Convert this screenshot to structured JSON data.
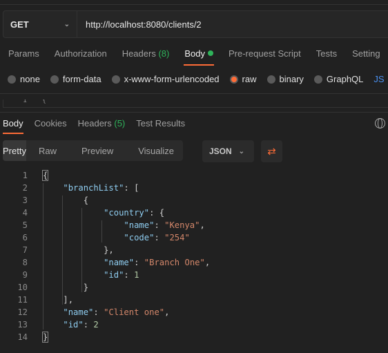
{
  "request": {
    "method": "GET",
    "url": "http://localhost:8080/clients/2"
  },
  "request_tabs": [
    {
      "label": "Params"
    },
    {
      "label": "Authorization"
    },
    {
      "label": "Headers",
      "count": "(8)"
    },
    {
      "label": "Body",
      "active": true
    },
    {
      "label": "Pre-request Script"
    },
    {
      "label": "Tests"
    },
    {
      "label": "Setting"
    }
  ],
  "body_types": [
    {
      "label": "none"
    },
    {
      "label": "form-data"
    },
    {
      "label": "x-www-form-urlencoded"
    },
    {
      "label": "raw",
      "selected": true
    },
    {
      "label": "binary"
    },
    {
      "label": "GraphQL"
    }
  ],
  "body_format_partial": "JS",
  "editor": {
    "line_number": "1",
    "content": "{"
  },
  "response_tabs": [
    {
      "label": "Body",
      "active": true
    },
    {
      "label": "Cookies"
    },
    {
      "label": "Headers",
      "count": "(5)"
    },
    {
      "label": "Test Results"
    }
  ],
  "view_modes": [
    "Pretty",
    "Raw",
    "Preview",
    "Visualize"
  ],
  "format": "JSON",
  "colors": {
    "accent": "#ff6c37",
    "success": "#2fb35a",
    "key": "#8fcdf0",
    "string": "#d4876a",
    "number": "#b5cea8"
  },
  "code_lines": [
    {
      "indent": 0,
      "tokens": [
        [
          "p",
          "{"
        ]
      ]
    },
    {
      "indent": 1,
      "tokens": [
        [
          "k",
          "\"branchList\""
        ],
        [
          "p",
          ": ["
        ]
      ]
    },
    {
      "indent": 2,
      "tokens": [
        [
          "p",
          "{"
        ]
      ]
    },
    {
      "indent": 3,
      "tokens": [
        [
          "k",
          "\"country\""
        ],
        [
          "p",
          ": {"
        ]
      ]
    },
    {
      "indent": 4,
      "tokens": [
        [
          "k",
          "\"name\""
        ],
        [
          "p",
          ": "
        ],
        [
          "s",
          "\"Kenya\""
        ],
        [
          "p",
          ","
        ]
      ]
    },
    {
      "indent": 4,
      "tokens": [
        [
          "k",
          "\"code\""
        ],
        [
          "p",
          ": "
        ],
        [
          "s",
          "\"254\""
        ]
      ]
    },
    {
      "indent": 3,
      "tokens": [
        [
          "p",
          "},"
        ]
      ]
    },
    {
      "indent": 3,
      "tokens": [
        [
          "k",
          "\"name\""
        ],
        [
          "p",
          ": "
        ],
        [
          "s",
          "\"Branch One\""
        ],
        [
          "p",
          ","
        ]
      ]
    },
    {
      "indent": 3,
      "tokens": [
        [
          "k",
          "\"id\""
        ],
        [
          "p",
          ": "
        ],
        [
          "n",
          "1"
        ]
      ]
    },
    {
      "indent": 2,
      "tokens": [
        [
          "p",
          "}"
        ]
      ]
    },
    {
      "indent": 1,
      "tokens": [
        [
          "p",
          "],"
        ]
      ]
    },
    {
      "indent": 1,
      "tokens": [
        [
          "k",
          "\"name\""
        ],
        [
          "p",
          ": "
        ],
        [
          "s",
          "\"Client one\""
        ],
        [
          "p",
          ","
        ]
      ]
    },
    {
      "indent": 1,
      "tokens": [
        [
          "k",
          "\"id\""
        ],
        [
          "p",
          ": "
        ],
        [
          "n",
          "2"
        ]
      ]
    },
    {
      "indent": 0,
      "tokens": [
        [
          "p",
          "}"
        ]
      ]
    }
  ]
}
